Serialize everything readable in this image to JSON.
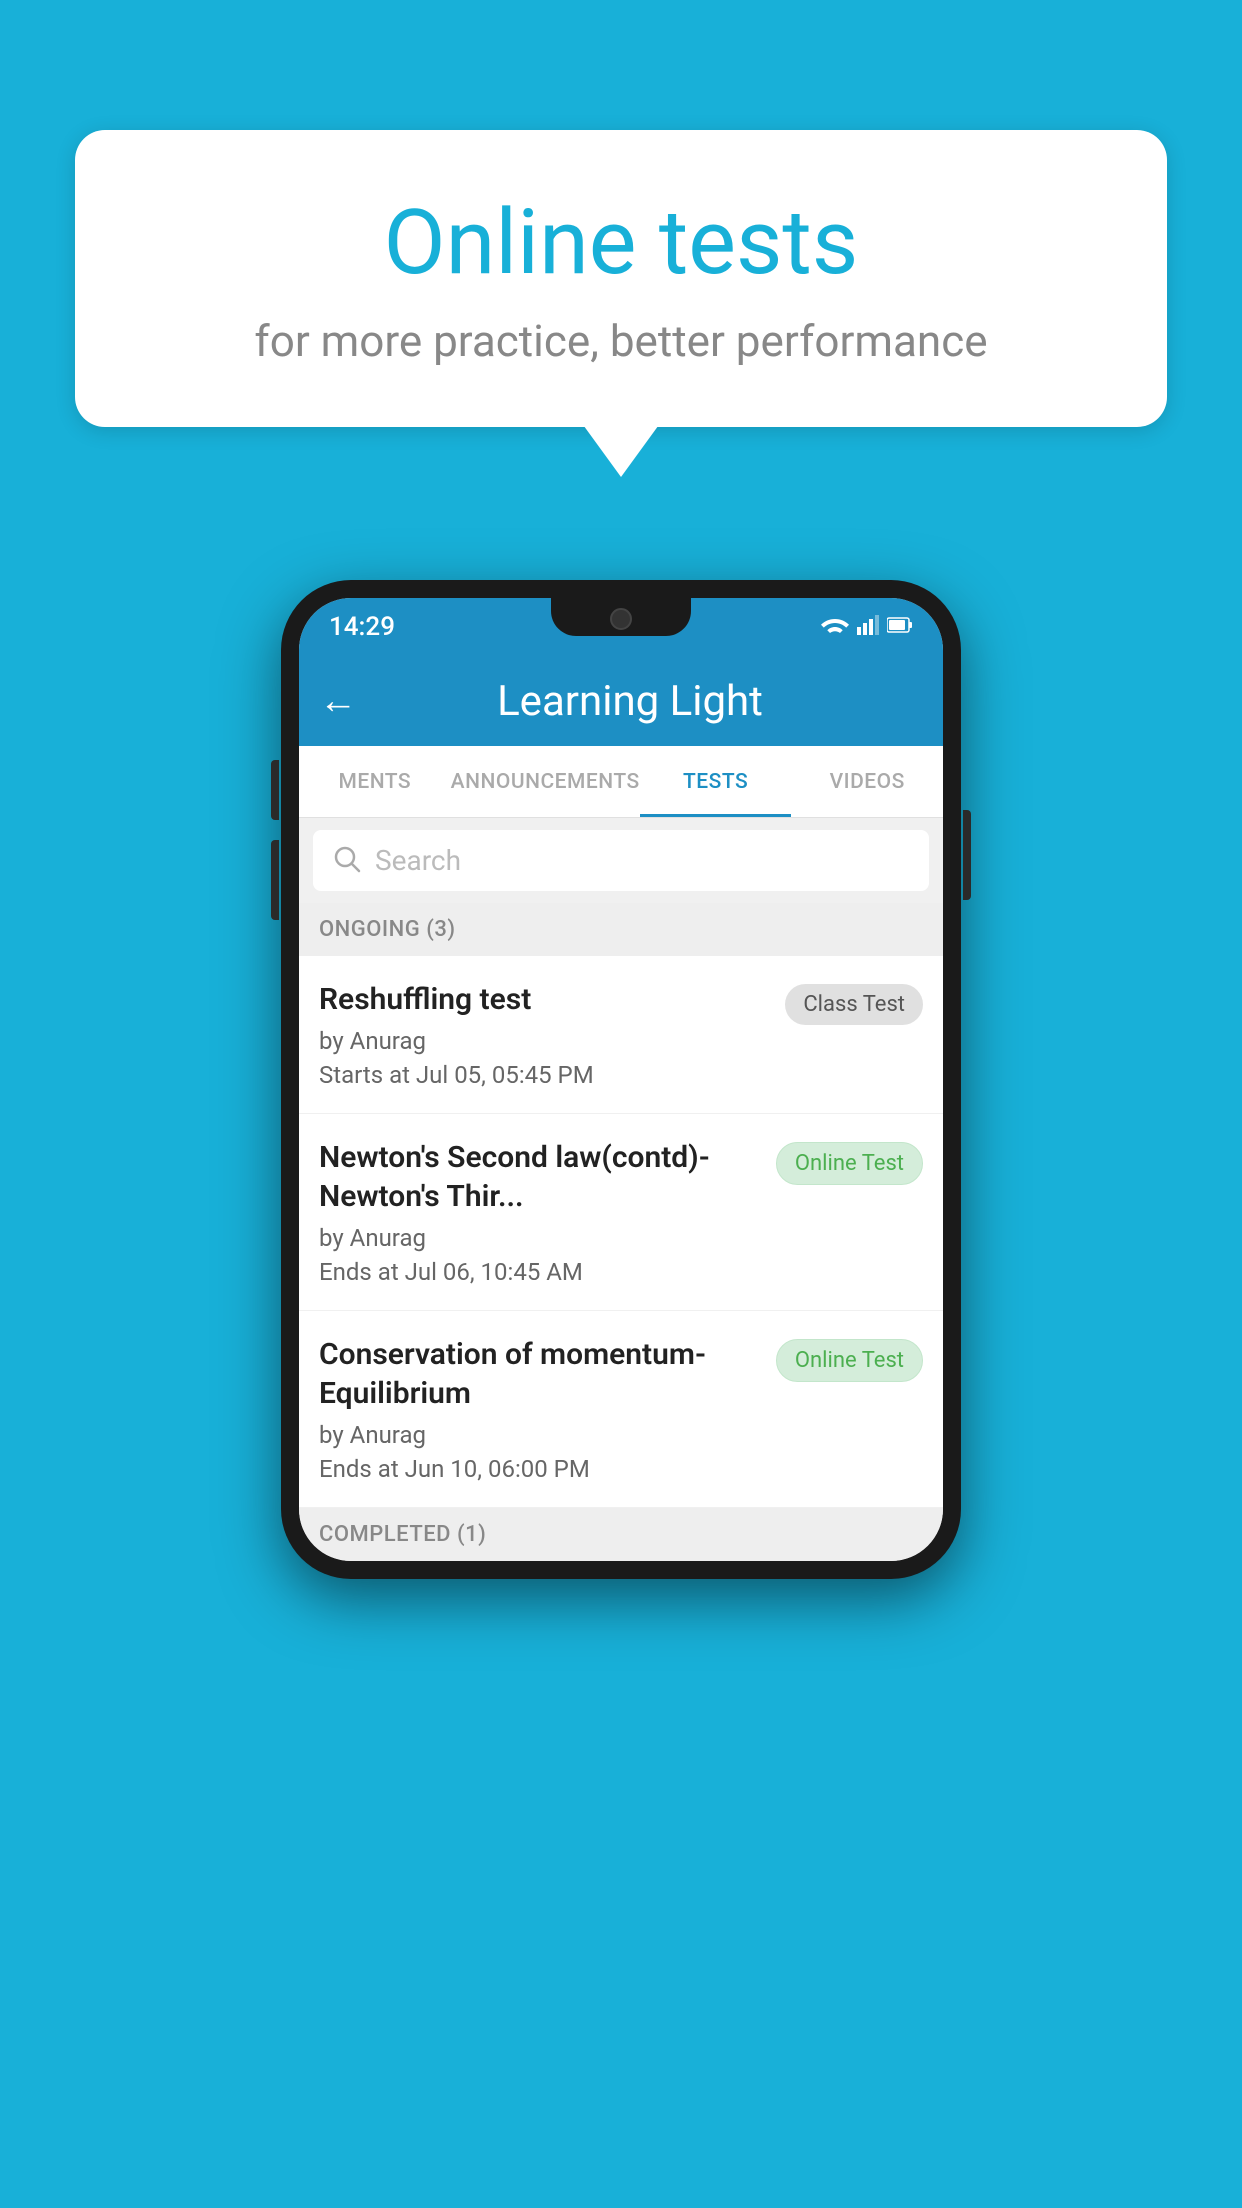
{
  "background": {
    "color": "#18b0d8"
  },
  "speech_bubble": {
    "title": "Online tests",
    "subtitle": "for more practice, better performance"
  },
  "status_bar": {
    "time": "14:29",
    "wifi": "▼",
    "signal": "▲",
    "battery": "▌"
  },
  "app_bar": {
    "back_label": "←",
    "title": "Learning Light"
  },
  "tabs": [
    {
      "label": "MENTS",
      "active": false
    },
    {
      "label": "ANNOUNCEMENTS",
      "active": false
    },
    {
      "label": "TESTS",
      "active": true
    },
    {
      "label": "VIDEOS",
      "active": false
    }
  ],
  "search": {
    "placeholder": "Search"
  },
  "sections": {
    "ongoing": {
      "label": "ONGOING (3)",
      "tests": [
        {
          "title": "Reshuffling test",
          "author": "by Anurag",
          "date": "Starts at  Jul 05, 05:45 PM",
          "badge": "Class Test",
          "badge_type": "class"
        },
        {
          "title": "Newton's Second law(contd)-Newton's Thir...",
          "author": "by Anurag",
          "date": "Ends at  Jul 06, 10:45 AM",
          "badge": "Online Test",
          "badge_type": "online"
        },
        {
          "title": "Conservation of momentum-Equilibrium",
          "author": "by Anurag",
          "date": "Ends at  Jun 10, 06:00 PM",
          "badge": "Online Test",
          "badge_type": "online"
        }
      ]
    },
    "completed": {
      "label": "COMPLETED (1)"
    }
  }
}
